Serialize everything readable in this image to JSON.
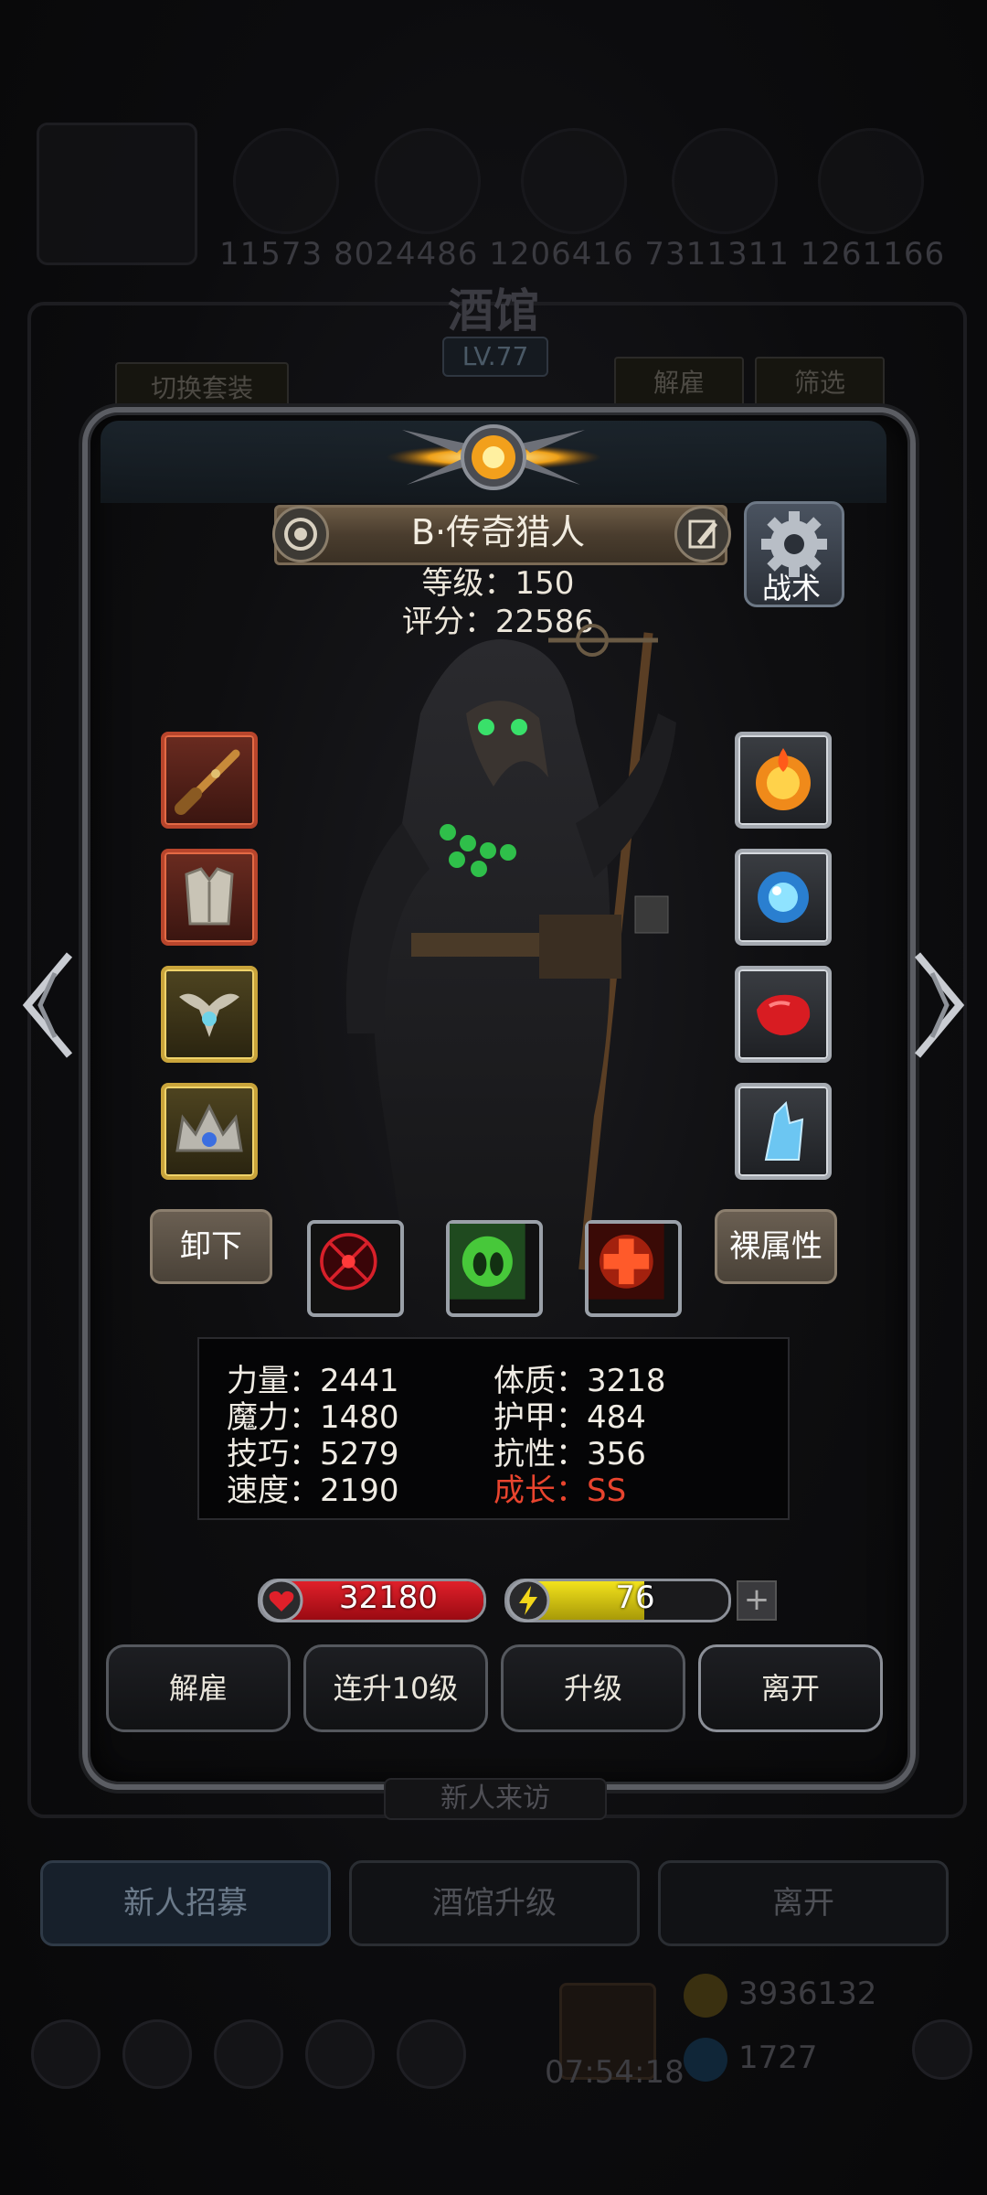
{
  "background": {
    "numbers": "11573  8024486  1206416  7311311  1261166",
    "title": "酒馆",
    "level": "LV.77",
    "switch_outfit": "切换套装",
    "dismiss": "解雇",
    "filter": "筛选",
    "new_visitor": "新人来访",
    "bottom_buttons": [
      "新人招募",
      "酒馆升级",
      "离开"
    ],
    "gold": "3936132",
    "gems": "1727",
    "timer": "07:54:18"
  },
  "hero": {
    "name": "B·传奇猎人",
    "level_line": "等级：150",
    "score_line": "评分：22586",
    "tactics": "战术",
    "unequip": "卸下",
    "base_attributes": "裸属性",
    "stats": [
      [
        "力量：2441",
        "体质：3218"
      ],
      [
        "魔力：1480",
        "护甲：484"
      ],
      [
        "技巧：5279",
        "抗性：356"
      ],
      [
        "速度：2190",
        "成长：SS"
      ]
    ],
    "hp": "32180",
    "energy": "76",
    "energy_fraction": 0.62,
    "actions": [
      "解雇",
      "连升10级",
      "升级",
      "离开"
    ]
  },
  "colors": {
    "growth": "#e8442e",
    "hp": "#d4131d",
    "energy": "#e6d618"
  },
  "icons": {
    "left_slots": [
      "musket-icon",
      "armor-icon",
      "amulet-icon",
      "crown-icon"
    ],
    "right_slots": [
      "flame-icon",
      "orb-icon",
      "red-gem-icon",
      "crystal-icon"
    ],
    "skills": [
      "target-skill-icon",
      "poison-skill-icon",
      "heal-skill-icon"
    ]
  }
}
